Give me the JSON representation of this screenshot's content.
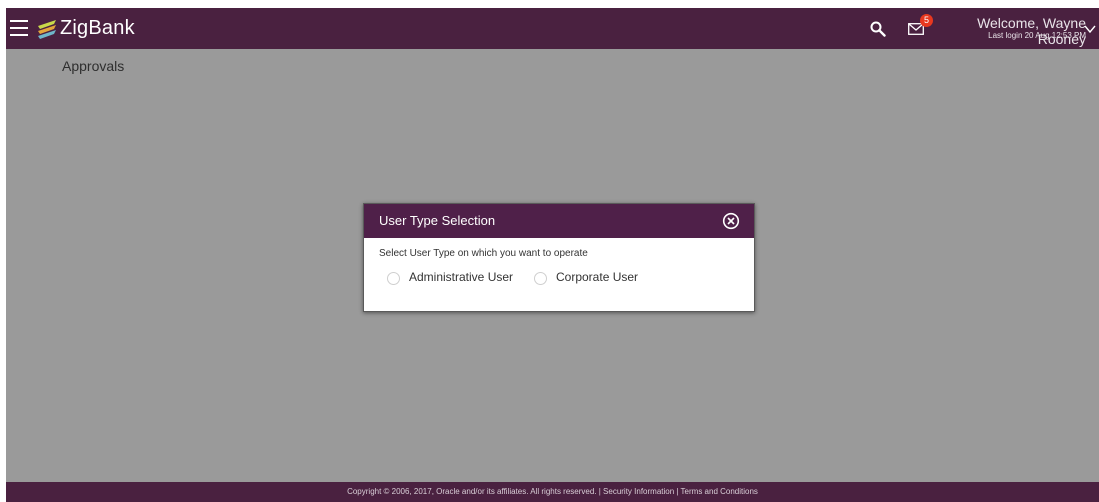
{
  "header": {
    "brand": "ZigBank",
    "notification_count": "5",
    "welcome": "Welcome, Wayne Rooney",
    "last_login": "Last login 20 Aug 12:53 PM",
    "icons": [
      "menu-icon",
      "logo-icon",
      "search-icon",
      "mail-icon",
      "chevron-down-icon"
    ]
  },
  "page": {
    "title": "Approvals"
  },
  "modal": {
    "title": "User Type Selection",
    "instruction": "Select User Type on which you want to operate",
    "options": [
      {
        "label": "Administrative User",
        "selected": false
      },
      {
        "label": "Corporate User",
        "selected": false
      }
    ]
  },
  "footer": {
    "text": "Copyright © 2006, 2017, Oracle and/or its affiliates. All rights reserved. | Security Information | Terms and Conditions"
  },
  "colors": {
    "header_bg": "#4a2140",
    "modal_header_bg": "#4f2049",
    "overlay_bg": "#9a9a9a",
    "badge": "#e8381f"
  }
}
